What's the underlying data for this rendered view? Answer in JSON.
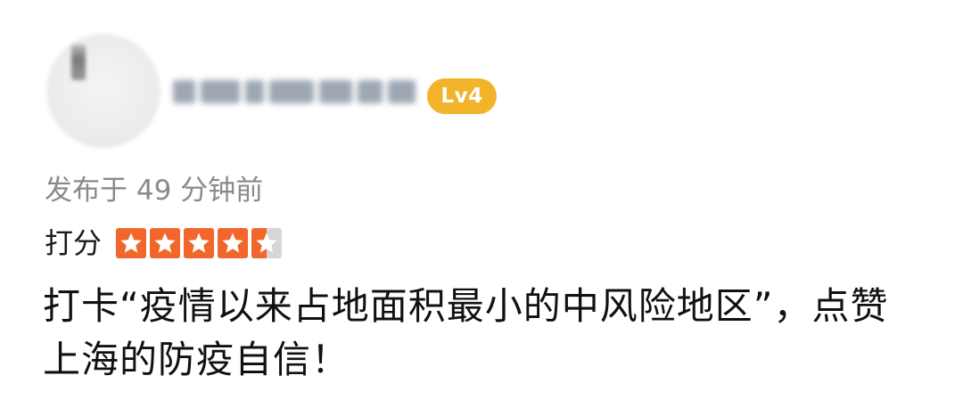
{
  "reviewer": {
    "name_blurred": true,
    "level": "Lv4"
  },
  "post_time": "发布于 49 分钟前",
  "rating": {
    "label": "打分",
    "value": 4.5,
    "max": 5
  },
  "review_text": "打卡“疫情以来占地面积最小的中风险地区”，点赞上海的防疫自信！",
  "colors": {
    "level_badge": "#f1b42b",
    "star_fill": "#f1672b",
    "star_empty": "#d6d6d6",
    "meta_text": "#8a8a8a"
  }
}
